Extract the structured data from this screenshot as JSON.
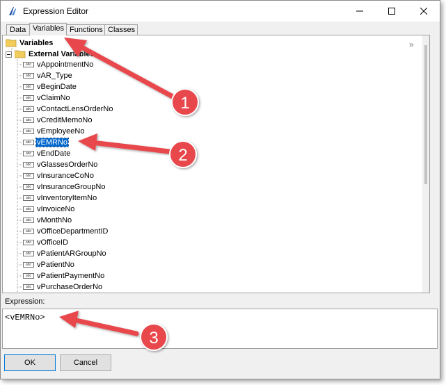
{
  "window": {
    "title": "Expression Editor"
  },
  "tabs": [
    {
      "label": "Data"
    },
    {
      "label": "Variables"
    },
    {
      "label": "Functions"
    },
    {
      "label": "Classes"
    }
  ],
  "tree": {
    "root_label": "Variables",
    "group_label": "External Variables",
    "items": [
      "vAppointmentNo",
      "vAR_Type",
      "vBeginDate",
      "vClaimNo",
      "vContactLensOrderNo",
      "vCreditMemoNo",
      "vEmployeeNo",
      "vEMRNo",
      "vEndDate",
      "vGlassesOrderNo",
      "vInsuranceCoNo",
      "vInsuranceGroupNo",
      "vInventoryItemNo",
      "vInvoiceNo",
      "vMonthNo",
      "vOfficeDepartmentID",
      "vOfficeID",
      "vPatientARGroupNo",
      "vPatientNo",
      "vPatientPaymentNo",
      "vPurchaseOrderNo"
    ],
    "selected_item": "vEMRNo",
    "collapse_glyph": "»"
  },
  "expression": {
    "label": "Expression:",
    "value": "<vEMRNo>"
  },
  "buttons": {
    "ok": "OK",
    "cancel": "Cancel"
  },
  "annotations": [
    "1",
    "2",
    "3"
  ],
  "colors": {
    "selection": "#0066cc",
    "annotation": "#e8474b"
  }
}
